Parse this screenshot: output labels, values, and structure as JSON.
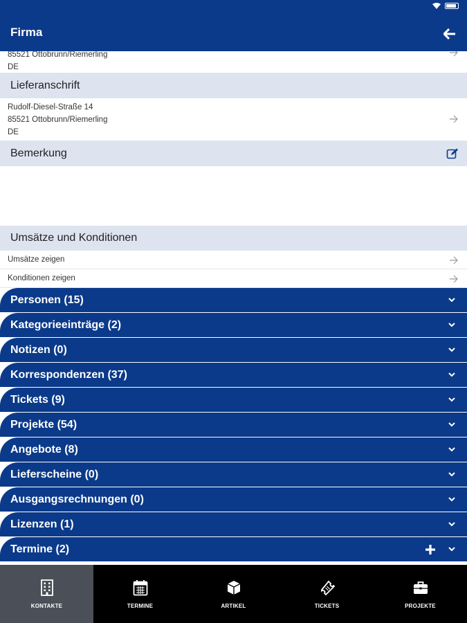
{
  "app_bar": {
    "title": "Firma"
  },
  "billing_address_partial": {
    "lines": [
      "85521 Ottobrunn/Riemerling",
      "DE"
    ]
  },
  "delivery": {
    "header": "Lieferanschrift",
    "lines": [
      "Rudolf-Diesel-Straße 14",
      "85521 Ottobrunn/Riemerling",
      "DE"
    ]
  },
  "remark": {
    "header": "Bemerkung"
  },
  "sales": {
    "header": "Umsätze und Konditionen",
    "links": [
      "Umsätze zeigen",
      "Konditionen zeigen"
    ]
  },
  "groups": [
    "Personen (15)",
    "Kategorieeinträge (2)",
    "Notizen (0)",
    "Korrespondenzen (37)",
    "Tickets (9)",
    "Projekte (54)",
    "Angebote (8)",
    "Lieferscheine (0)",
    "Ausgangsrechnungen (0)",
    "Lizenzen (1)",
    "Termine (2)"
  ],
  "bottom_nav": {
    "items": [
      "KONTAKTE",
      "TERMINE",
      "ARTIKEL",
      "TICKETS",
      "PROJEKTE"
    ],
    "active": "KONTAKTE",
    "icons": [
      "building-icon",
      "calendar-icon",
      "box-icon",
      "ticket-icon",
      "briefcase-icon"
    ]
  },
  "colors": {
    "primary": "#0b3a8a",
    "section_bg": "#dde3ef",
    "nav_bg": "#000000",
    "nav_active": "#4b4f57"
  }
}
